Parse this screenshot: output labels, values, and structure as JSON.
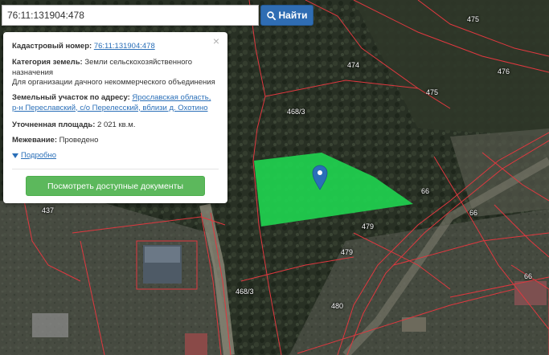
{
  "search": {
    "value": "76:11:131904:478",
    "button_label": "Найти"
  },
  "popup": {
    "cadastral_label": "Кадастровый номер:",
    "cadastral_value": "76:11:131904:478",
    "category_label": "Категория земель:",
    "category_value": "Земли сельскохозяйственного назначения",
    "usage": "Для организации дачного некоммерческого объединения",
    "address_label": "Земельный участок по адресу:",
    "address_line1": "Ярославская область,",
    "address_line2": "р-н Переславский, с/о Перелесский, вблизи д. Охотино",
    "area_label": "Уточненная площадь:",
    "area_value": "2 021 кв.м.",
    "survey_label": "Межевание:",
    "survey_value": "Проведено",
    "more_link": "Подробно",
    "docs_button": "Посмотреть доступные документы",
    "close_symbol": "×"
  },
  "map": {
    "parcel_labels": [
      "474",
      "475",
      "476",
      "475",
      "468/3",
      "66",
      "66",
      "479",
      "479",
      "437",
      "468/3",
      "480",
      "66"
    ],
    "highlight_color": "#1fd14f",
    "boundary_color": "#e0383f",
    "pin_color": "#2a6fb8"
  }
}
